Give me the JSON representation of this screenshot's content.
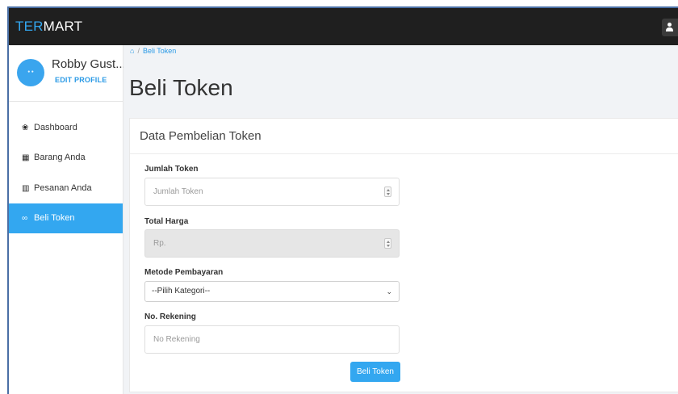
{
  "app": {
    "brand_part1": "TER",
    "brand_part2": "MART",
    "accent_color": "#33a7f0",
    "navbar_color": "#1f1f1f"
  },
  "user": {
    "name": "Robby Gust...",
    "edit_profile": "EDIT PROFILE",
    "avatar_icon": "user-icon"
  },
  "sidebar": {
    "items": [
      {
        "label": "Dashboard",
        "icon": "dashboard-icon",
        "active": false
      },
      {
        "label": "Barang Anda",
        "icon": "calendar-icon",
        "active": false
      },
      {
        "label": "Pesanan Anda",
        "icon": "bar-chart-icon",
        "active": false
      },
      {
        "label": "Beli Token",
        "icon": "token-icon",
        "active": true
      }
    ]
  },
  "breadcrumb": {
    "home_icon": "home-icon",
    "current": "Beli Token"
  },
  "page": {
    "title": "Beli Token"
  },
  "card": {
    "title": "Data Pembelian Token"
  },
  "form": {
    "jumlah_token": {
      "label": "Jumlah Token",
      "placeholder": "Jumlah Token",
      "value": ""
    },
    "total_harga": {
      "label": "Total Harga",
      "placeholder": "Rp.",
      "value": "",
      "disabled": true
    },
    "metode": {
      "label": "Metode Pembayaran",
      "selected": "--Pilih Kategori--"
    },
    "rekening": {
      "label": "No. Rekening",
      "placeholder": "No Rekening",
      "value": ""
    },
    "submit_label": "Beli Token"
  }
}
